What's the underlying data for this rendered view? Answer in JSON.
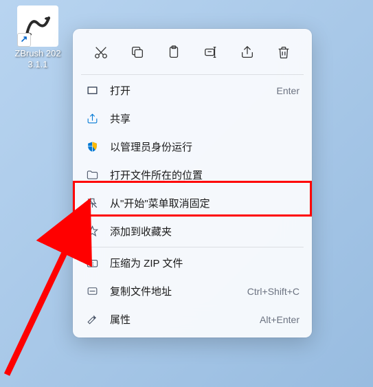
{
  "desktop": {
    "icon_name": "ZBrush 2023.1.1"
  },
  "toolbar": {
    "cut": "剪切",
    "copy": "复制",
    "paste": "粘贴",
    "rename": "重命名",
    "share": "分享",
    "delete": "删除"
  },
  "menu": {
    "open": {
      "label": "打开",
      "shortcut": "Enter"
    },
    "share": {
      "label": "共享"
    },
    "run_as_admin": {
      "label": "以管理员身份运行"
    },
    "open_location": {
      "label": "打开文件所在的位置"
    },
    "unpin_start": {
      "label": "从\"开始\"菜单取消固定"
    },
    "add_favorites": {
      "label": "添加到收藏夹"
    },
    "compress_zip": {
      "label": "压缩为 ZIP 文件"
    },
    "copy_path": {
      "label": "复制文件地址",
      "shortcut": "Ctrl+Shift+C"
    },
    "properties": {
      "label": "属性",
      "shortcut": "Alt+Enter"
    }
  }
}
